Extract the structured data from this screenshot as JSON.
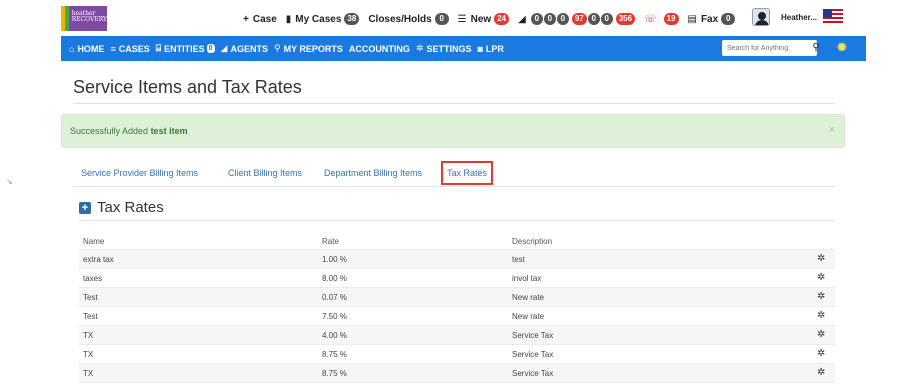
{
  "logo": {
    "line1": "heather",
    "line2": "RECOVERY"
  },
  "topnav": {
    "case_label": "Case",
    "mycases_label": "My Cases",
    "mycases_count": "38",
    "closes_label": "Closes/Holds",
    "closes_count": "0",
    "new_label": "New",
    "new_count": "24",
    "queue_counts": [
      "0",
      "0",
      "0",
      "97",
      "0",
      "0",
      "356"
    ],
    "phone_count": "19",
    "fax_label": "Fax",
    "fax_count": "0",
    "user_name": "Heather..."
  },
  "navbar": {
    "home": "HOME",
    "cases": "CASES",
    "entities": "ENTITIES",
    "entities_count": "0",
    "agents": "AGENTS",
    "my_reports": "MY REPORTS",
    "accounting": "ACCOUNTING",
    "settings": "SETTINGS",
    "lpr": "LPR",
    "search_placeholder": "Search for Anything"
  },
  "page": {
    "title": "Service Items and Tax Rates",
    "alert_prefix": "Successfully Added",
    "alert_item": "test item",
    "alert_close": "×"
  },
  "tabs": [
    {
      "label": "Service Provider Billing Items"
    },
    {
      "label": "Client Billing Items"
    },
    {
      "label": "Department Billing Items"
    },
    {
      "label": "Tax Rates"
    }
  ],
  "section": {
    "title": "Tax Rates"
  },
  "table": {
    "headers": {
      "name": "Name",
      "rate": "Rate",
      "description": "Description"
    },
    "rows": [
      {
        "name": "extra tax",
        "rate": "1.00 %",
        "description": "test"
      },
      {
        "name": "taxes",
        "rate": "8.00 %",
        "description": "invol tax"
      },
      {
        "name": "Test",
        "rate": "0.07 %",
        "description": "New rate"
      },
      {
        "name": "Test",
        "rate": "7.50 %",
        "description": "New rate"
      },
      {
        "name": "TX",
        "rate": "4.00 %",
        "description": "Service Tax"
      },
      {
        "name": "TX",
        "rate": "8.75 %",
        "description": "Service Tax"
      },
      {
        "name": "TX",
        "rate": "8.75 %",
        "description": "Service Tax"
      }
    ]
  },
  "colors": {
    "nav_blue": "#1b7ae0",
    "badge_red": "#e23a2c",
    "alert_bg": "#dff0d8",
    "link_blue": "#3a6fb8"
  }
}
